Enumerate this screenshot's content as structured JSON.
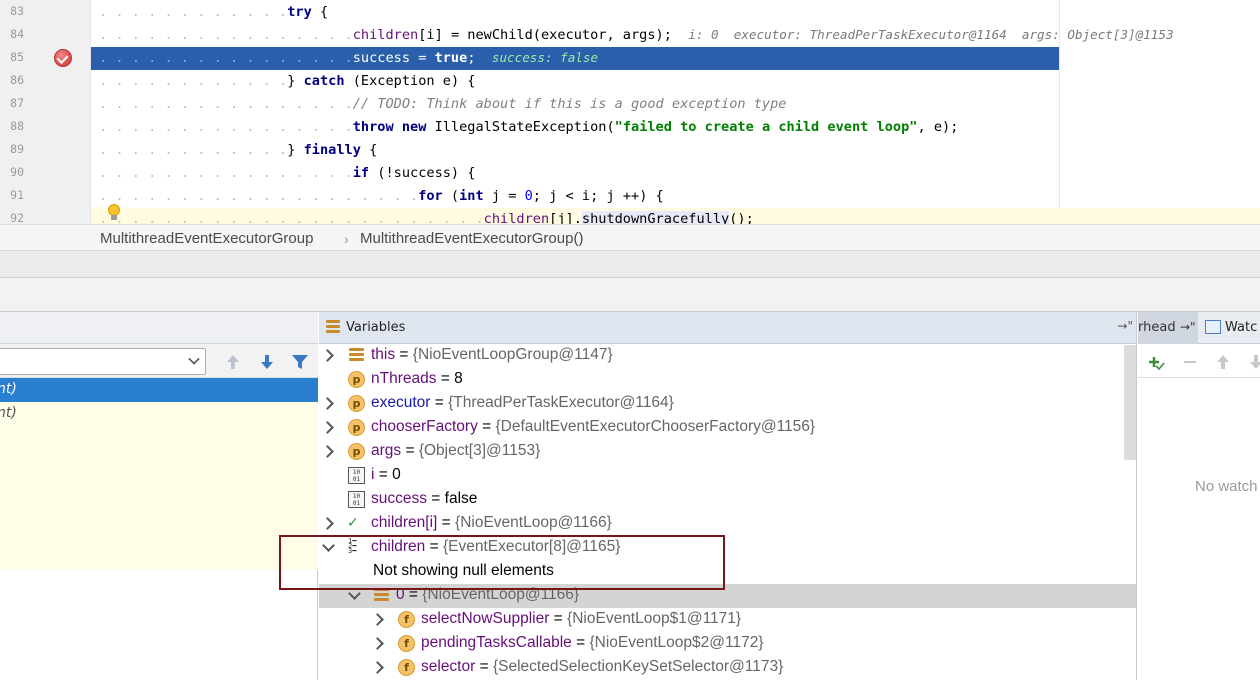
{
  "editor": {
    "lines": [
      {
        "num": "83",
        "code": "try {"
      },
      {
        "num": "84",
        "code": "children[i] = newChild(executor, args);",
        "inline": "i: 0  executor: ThreadPerTaskExecutor@1164  args: Object[3]@1153"
      },
      {
        "num": "85",
        "code": "success = true;",
        "inline": "success: false"
      },
      {
        "num": "86",
        "code": "} catch (Exception e) {"
      },
      {
        "num": "87",
        "code": "// TODO: Think about if this is a good exception type"
      },
      {
        "num": "88",
        "code": "throw new IllegalStateException(\"failed to create a child event loop\", e);"
      },
      {
        "num": "89",
        "code": "} finally {"
      },
      {
        "num": "90",
        "code": "if (!success) {"
      },
      {
        "num": "91",
        "code": "for (int j = 0; j < i; j ++) {"
      },
      {
        "num": "92",
        "code": "children[j].shutdownGracefully();"
      }
    ]
  },
  "breadcrumb": {
    "class_name": "MultithreadEventExecutorGroup",
    "method_name": "MultithreadEventExecutorGroup()",
    "separator": "›"
  },
  "frames": {
    "items": [
      {
        "label": "nt)",
        "selected": true
      },
      {
        "label": "nt)",
        "selected": false
      }
    ]
  },
  "variables": {
    "title": "Variables",
    "pin_label": "→\"",
    "rows": [
      {
        "name": "this",
        "eq": " = ",
        "value": "{NioEventLoopGroup@1147}",
        "icon": "obj"
      },
      {
        "name": "nThreads",
        "eq": " = ",
        "value": "8",
        "icon": "p"
      },
      {
        "name": "executor",
        "eq": " = ",
        "value": "{ThreadPerTaskExecutor@1164}",
        "icon": "p"
      },
      {
        "name": "chooserFactory",
        "eq": " = ",
        "value": "{DefaultEventExecutorChooserFactory@1156}",
        "icon": "p"
      },
      {
        "name": "args",
        "eq": " = ",
        "value": "{Object[3]@1153}",
        "icon": "p"
      },
      {
        "name": "i",
        "eq": " = ",
        "value": "0",
        "icon": "prim"
      },
      {
        "name": "success",
        "eq": " = ",
        "value": "false",
        "icon": "prim"
      },
      {
        "name": "children[i]",
        "eq": " = ",
        "value": "{NioEventLoop@1166}",
        "icon": "watch"
      },
      {
        "name": "children",
        "eq": " = ",
        "value": "{EventExecutor[8]@1165}",
        "icon": "arr"
      },
      {
        "info": "Not showing null elements"
      },
      {
        "name": "0",
        "eq": " = ",
        "value": "{NioEventLoop@1166}",
        "icon": "obj"
      },
      {
        "name": "selectNowSupplier",
        "eq": " = ",
        "value": "{NioEventLoop$1@1171}",
        "icon": "f"
      },
      {
        "name": "pendingTasksCallable",
        "eq": " = ",
        "value": "{NioEventLoop$2@1172}",
        "icon": "f"
      },
      {
        "name": "selector",
        "eq": " = ",
        "value": "{SelectedSelectionKeySetSelector@1173}",
        "icon": "f"
      }
    ]
  },
  "watches": {
    "threads_tab": "rhead",
    "threads_pin": "→\"",
    "tab_label": "Watc",
    "empty_text": "No watch"
  },
  "colors": {
    "selection": "#2a5fab",
    "frame_selected": "#2b7fd0",
    "annotation_box": "#7b1418"
  }
}
